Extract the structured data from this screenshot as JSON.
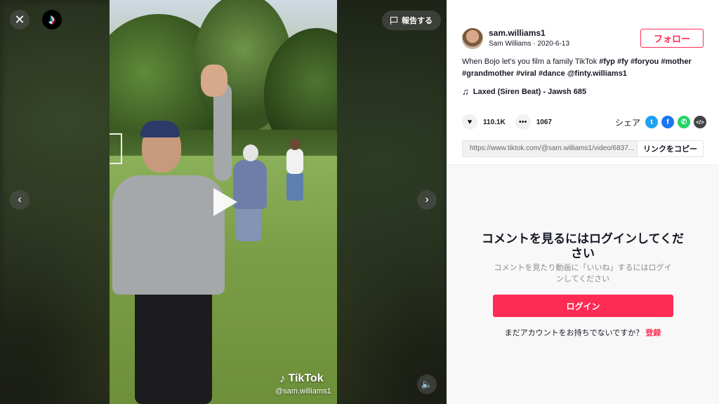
{
  "player": {
    "report_label": "報告する",
    "watermark_brand": "TikTok",
    "watermark_user": "@sam.williams1"
  },
  "author": {
    "username": "sam.williams1",
    "display_name": "Sam Williams",
    "separator": " · ",
    "date": "2020-6-13",
    "follow_label": "フォロー"
  },
  "caption": {
    "text": "When Bojo let's you film a family TikTok ",
    "tags": [
      "#fyp",
      "#fy",
      "#foryou",
      "#mother",
      "#grandmother",
      "#viral",
      "#dance",
      "@finty.williams1"
    ]
  },
  "music": {
    "title": "Laxed (Siren Beat) - Jawsh 685"
  },
  "stats": {
    "likes": "110.1K",
    "comments": "1067"
  },
  "share": {
    "label": "シェア"
  },
  "link": {
    "url": "https://www.tiktok.com/@sam.williams1/video/6837...",
    "copy_label": "リンクをコピー"
  },
  "comments_gate": {
    "title": "コメントを見るにはログインしてください",
    "subtitle": "コメントを見たり動画に「いいね」するにはログインしてください",
    "login_label": "ログイン",
    "signup_prompt": "まだアカウントをお持ちでないですか？",
    "signup_link": "登録"
  },
  "colors": {
    "accent": "#fe2c55",
    "twitter": "#1da1f2",
    "facebook": "#1877f2",
    "whatsapp": "#25d366"
  }
}
